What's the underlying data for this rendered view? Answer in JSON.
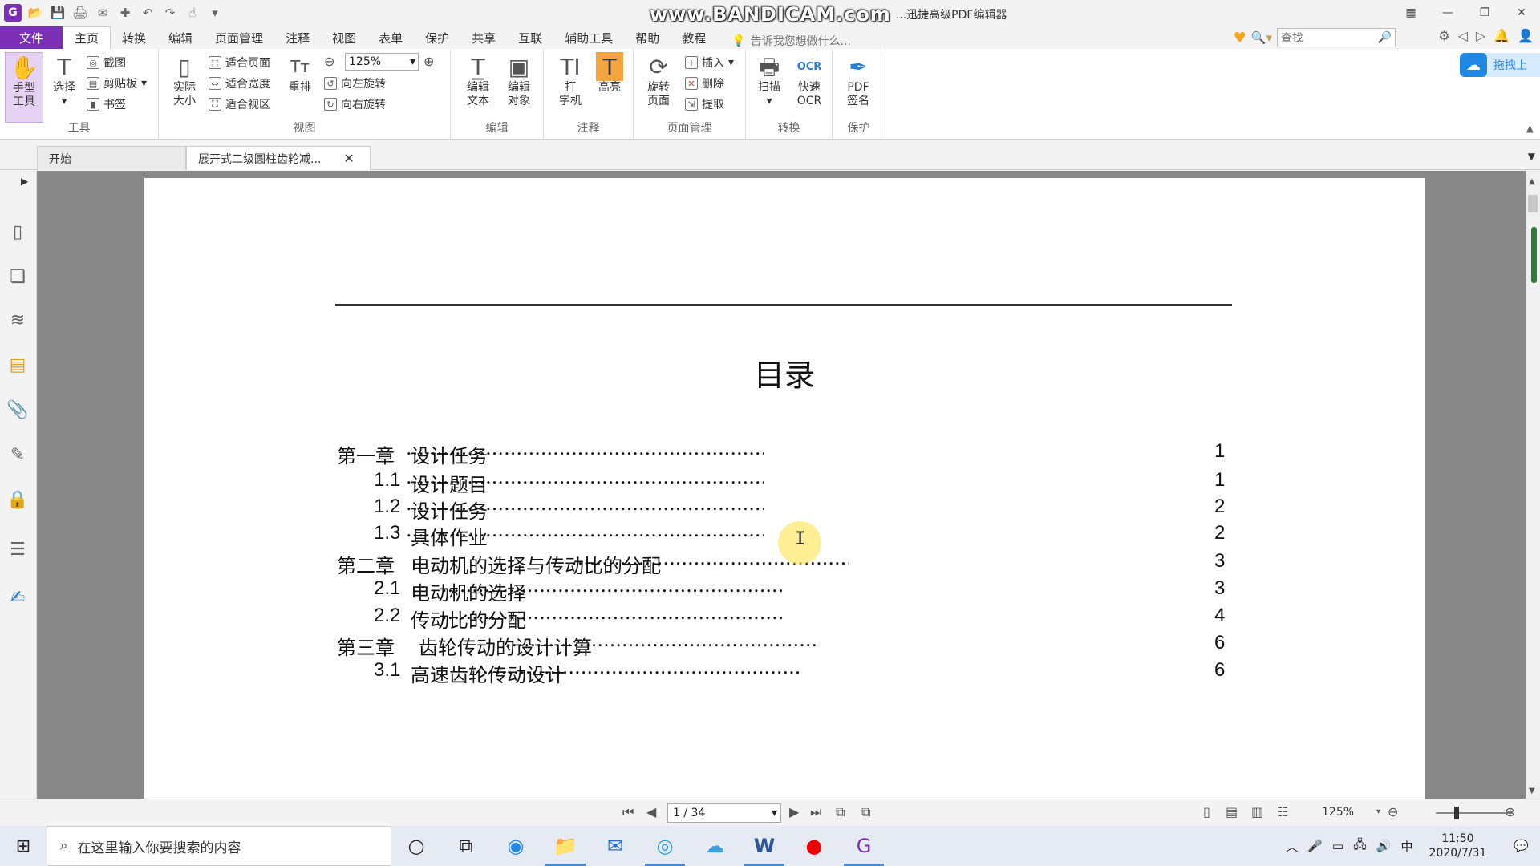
{
  "titlebar": {
    "watermark": "www.BANDICAM.com",
    "title": "...迅捷高级PDF编辑器"
  },
  "menu": {
    "file": "文件",
    "tabs": [
      "主页",
      "转换",
      "编辑",
      "页面管理",
      "注释",
      "视图",
      "表单",
      "保护",
      "共享",
      "互联",
      "辅助工具",
      "帮助",
      "教程"
    ],
    "tell_me": "告诉我您想做什么...",
    "search_placeholder": "查找"
  },
  "ribbon": {
    "hand_tool": "手型\n工具",
    "select": "选择",
    "screenshot": "截图",
    "clipboard": "剪贴板",
    "bookmark": "书签",
    "tools_group": "工具",
    "actual_size": "实际\n大小",
    "fit_page": "适合页面",
    "fit_width": "适合宽度",
    "fit_view": "适合视区",
    "reflow": "重排",
    "zoom_value": "125%",
    "rotate_left": "向左旋转",
    "rotate_right": "向右旋转",
    "view_group": "视图",
    "edit_text": "编辑\n文本",
    "edit_object": "编辑\n对象",
    "edit_group": "编辑",
    "typewriter": "打\n字机",
    "highlight": "高亮",
    "annotate_group": "注释",
    "rotate_page": "旋转\n页面",
    "insert": "插入",
    "delete": "删除",
    "extract": "提取",
    "page_group": "页面管理",
    "scan": "扫描",
    "quick_ocr": "快速\nOCR",
    "convert_group": "转换",
    "pdf_sign": "PDF\n签名",
    "protect_group": "保护",
    "cloud": "拖拽上"
  },
  "doctabs": {
    "start": "开始",
    "document": "展开式二级圆柱齿轮减..."
  },
  "page": {
    "title": "目录",
    "toc": [
      {
        "num": "第一章",
        "text": "设计任务",
        "page": "1",
        "level": 0
      },
      {
        "num": "1.1",
        "text": "设计题目",
        "page": "1",
        "level": 1
      },
      {
        "num": "1.2",
        "text": "设计任务",
        "page": "2",
        "level": 1
      },
      {
        "num": "1.3",
        "text": "具体作业",
        "page": "2",
        "level": 1
      },
      {
        "num": "第二章",
        "text": "电动机的选择与传动比的分配",
        "page": "3",
        "level": 0
      },
      {
        "num": "2.1",
        "text": "电动机的选择",
        "page": "3",
        "level": 1
      },
      {
        "num": "2.2",
        "text": "传动比的分配",
        "page": "4",
        "level": 1
      },
      {
        "num": "第三章",
        "text": "齿轮传动的设计计算",
        "page": "6",
        "level": 0
      },
      {
        "num": "3.1",
        "text": "高速齿轮传动设计",
        "page": "6",
        "level": 1
      }
    ]
  },
  "status": {
    "page_indicator": "1 / 34",
    "zoom": "125%"
  },
  "taskbar": {
    "search": "在这里输入你要搜索的内容",
    "time": "11:50",
    "date": "2020/7/31",
    "ime": "中"
  }
}
